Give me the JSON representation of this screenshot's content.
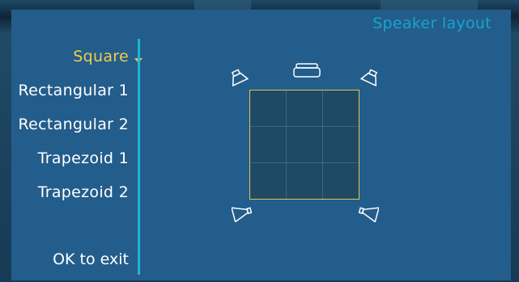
{
  "title": "Speaker layout",
  "menu": {
    "items": [
      {
        "label": "Square",
        "selected": true
      },
      {
        "label": "Rectangular 1",
        "selected": false
      },
      {
        "label": "Rectangular 2",
        "selected": false
      },
      {
        "label": "Trapezoid 1",
        "selected": false
      },
      {
        "label": "Trapezoid 2",
        "selected": false
      }
    ]
  },
  "footer": {
    "ok_text": "OK to exit"
  },
  "colors": {
    "panel": "#235d8c",
    "accent": "#1eb4d4",
    "title": "#1aa3c8",
    "selected": "#f0cd4a",
    "text": "#ffffff",
    "room_border": "#e6c24a"
  },
  "speakers": [
    {
      "name": "front-left",
      "icon": "speaker-icon"
    },
    {
      "name": "center",
      "icon": "center-speaker-icon"
    },
    {
      "name": "front-right",
      "icon": "speaker-icon"
    },
    {
      "name": "rear-left",
      "icon": "speaker-icon"
    },
    {
      "name": "rear-right",
      "icon": "speaker-icon"
    }
  ]
}
